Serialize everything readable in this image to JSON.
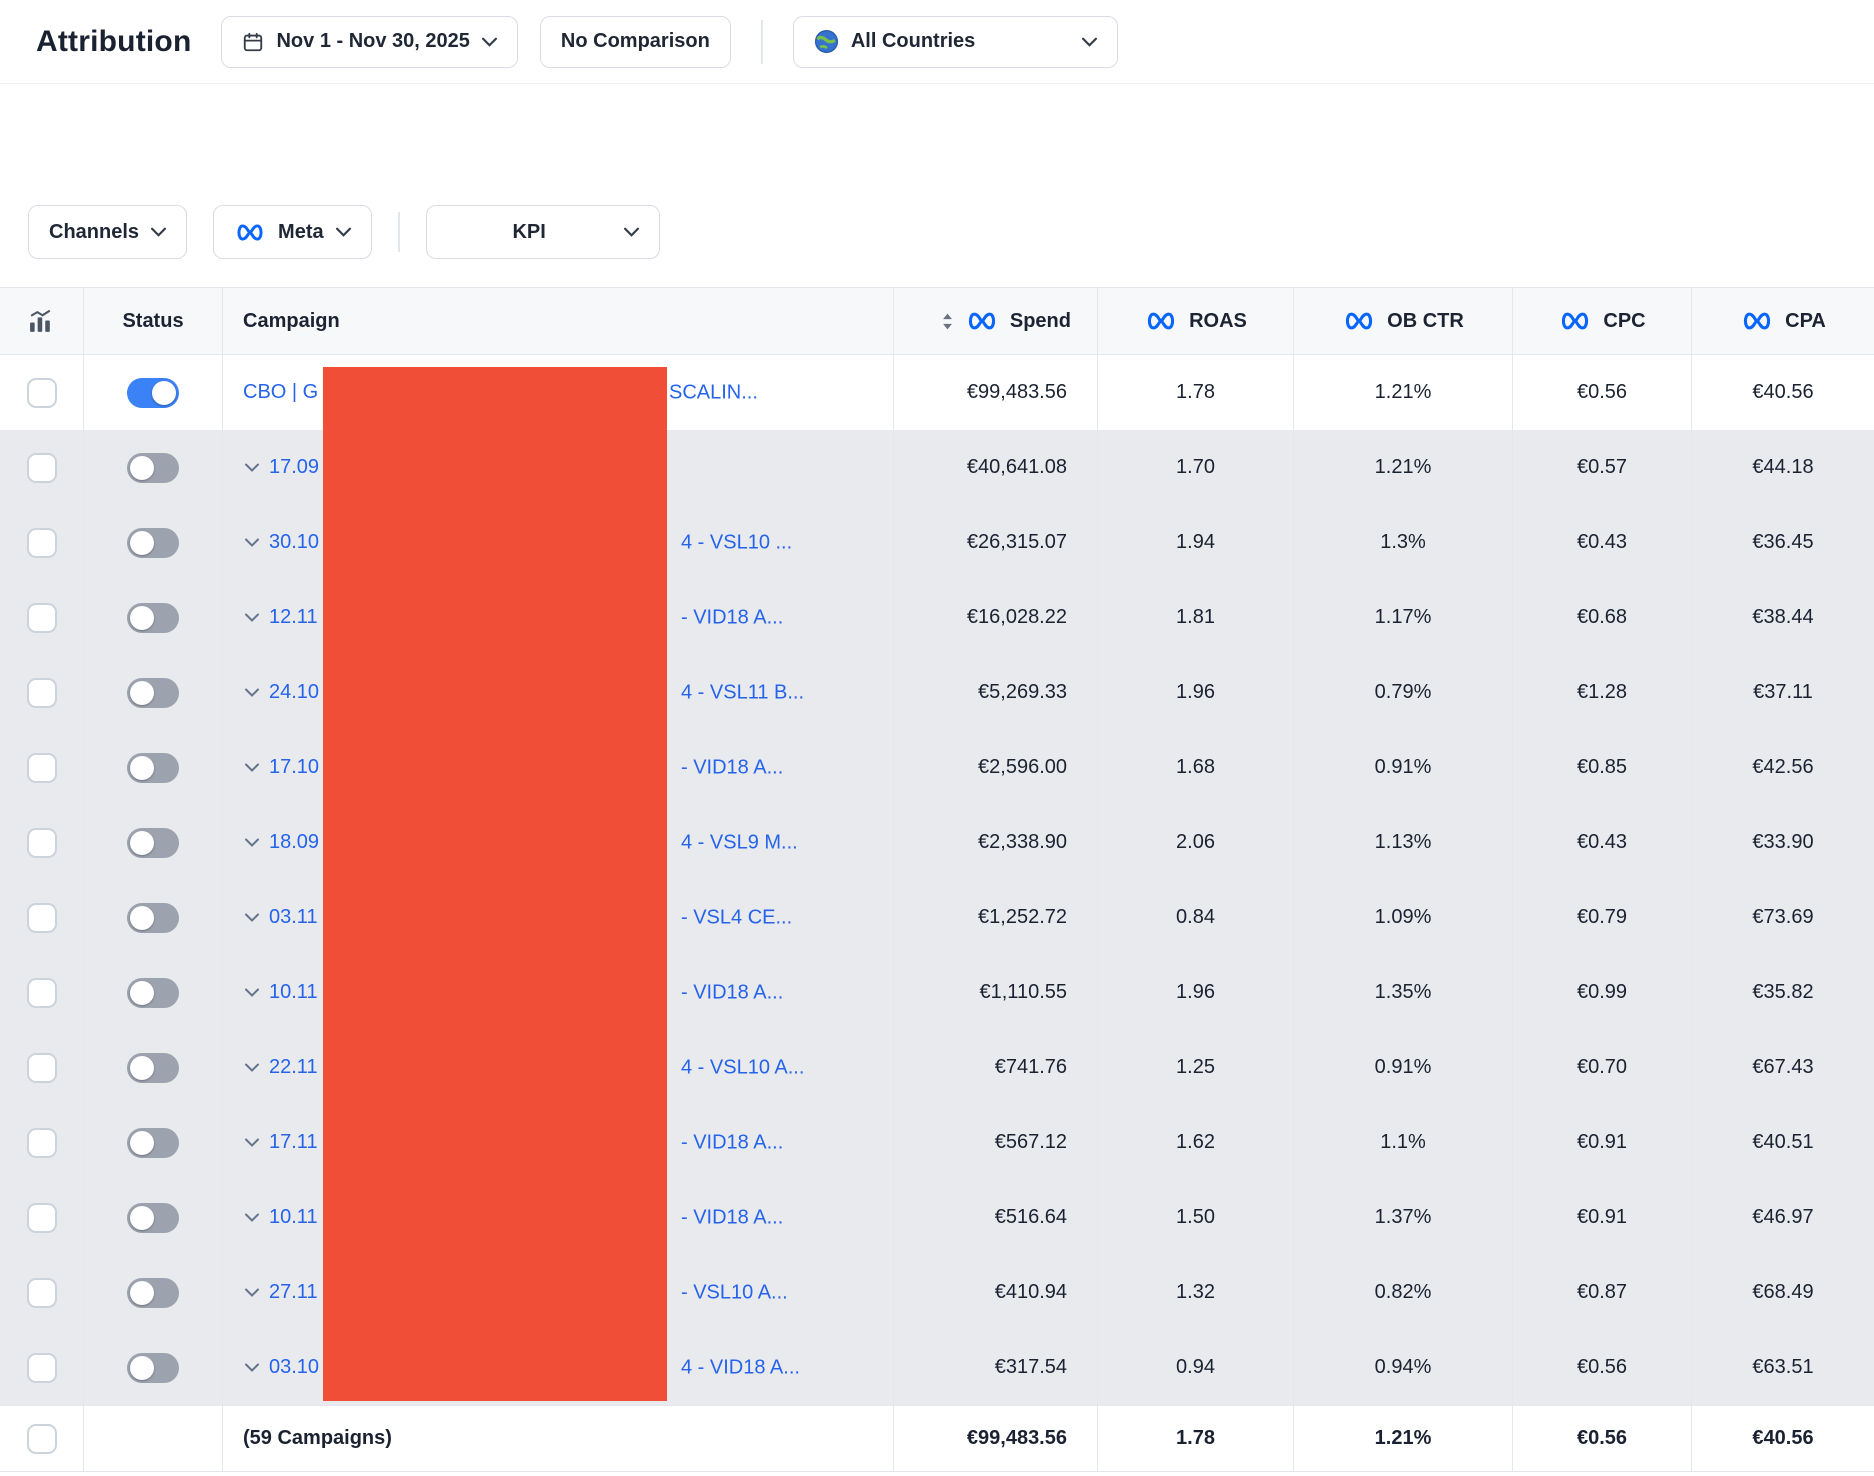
{
  "page": {
    "title": "Attribution"
  },
  "toolbar": {
    "date_range": "Nov 1 - Nov 30, 2025",
    "comparison": "No Comparison",
    "countries": "All Countries"
  },
  "filters": {
    "channels_label": "Channels",
    "channel_selected": "Meta",
    "kpi_label": "KPI"
  },
  "table": {
    "columns": {
      "status": "Status",
      "campaign": "Campaign",
      "spend": "Spend",
      "roas": "ROAS",
      "ob_ctr": "OB CTR",
      "cpc": "CPC",
      "cpa": "CPA"
    },
    "rows": [
      {
        "name_left": "CBO | G",
        "name_right": "SCALIN...",
        "toggle": "on",
        "spend": "€99,483.56",
        "roas": "1.78",
        "ob_ctr": "1.21%",
        "cpc": "€0.56",
        "cpa": "€40.56"
      },
      {
        "name_left": "17.09",
        "name_right": "",
        "toggle": "off",
        "spend": "€40,641.08",
        "roas": "1.70",
        "ob_ctr": "1.21%",
        "cpc": "€0.57",
        "cpa": "€44.18"
      },
      {
        "name_left": "30.10",
        "name_right": "4 - VSL10 ...",
        "toggle": "off",
        "spend": "€26,315.07",
        "roas": "1.94",
        "ob_ctr": "1.3%",
        "cpc": "€0.43",
        "cpa": "€36.45"
      },
      {
        "name_left": "12.11",
        "name_right": "- VID18 A...",
        "toggle": "off",
        "spend": "€16,028.22",
        "roas": "1.81",
        "ob_ctr": "1.17%",
        "cpc": "€0.68",
        "cpa": "€38.44"
      },
      {
        "name_left": "24.10",
        "name_right": "4 - VSL11 B...",
        "toggle": "off",
        "spend": "€5,269.33",
        "roas": "1.96",
        "ob_ctr": "0.79%",
        "cpc": "€1.28",
        "cpa": "€37.11"
      },
      {
        "name_left": "17.10",
        "name_right": "- VID18 A...",
        "toggle": "off",
        "spend": "€2,596.00",
        "roas": "1.68",
        "ob_ctr": "0.91%",
        "cpc": "€0.85",
        "cpa": "€42.56"
      },
      {
        "name_left": "18.09",
        "name_right": "4 - VSL9 M...",
        "toggle": "off",
        "spend": "€2,338.90",
        "roas": "2.06",
        "ob_ctr": "1.13%",
        "cpc": "€0.43",
        "cpa": "€33.90"
      },
      {
        "name_left": "03.11",
        "name_right": "- VSL4 CE...",
        "toggle": "off",
        "spend": "€1,252.72",
        "roas": "0.84",
        "ob_ctr": "1.09%",
        "cpc": "€0.79",
        "cpa": "€73.69"
      },
      {
        "name_left": "10.11",
        "name_right": "- VID18 A...",
        "toggle": "off",
        "spend": "€1,110.55",
        "roas": "1.96",
        "ob_ctr": "1.35%",
        "cpc": "€0.99",
        "cpa": "€35.82"
      },
      {
        "name_left": "22.11",
        "name_right": "4 - VSL10 A...",
        "toggle": "off",
        "spend": "€741.76",
        "roas": "1.25",
        "ob_ctr": "0.91%",
        "cpc": "€0.70",
        "cpa": "€67.43"
      },
      {
        "name_left": "17.11",
        "name_right": "- VID18 A...",
        "toggle": "off",
        "spend": "€567.12",
        "roas": "1.62",
        "ob_ctr": "1.1%",
        "cpc": "€0.91",
        "cpa": "€40.51"
      },
      {
        "name_left": "10.11",
        "name_right": "- VID18 A...",
        "toggle": "off",
        "spend": "€516.64",
        "roas": "1.50",
        "ob_ctr": "1.37%",
        "cpc": "€0.91",
        "cpa": "€46.97"
      },
      {
        "name_left": "27.11",
        "name_right": "- VSL10 A...",
        "toggle": "off",
        "spend": "€410.94",
        "roas": "1.32",
        "ob_ctr": "0.82%",
        "cpc": "€0.87",
        "cpa": "€68.49"
      },
      {
        "name_left": "03.10",
        "name_right": "4 - VID18 A...",
        "toggle": "off",
        "spend": "€317.54",
        "roas": "0.94",
        "ob_ctr": "0.94%",
        "cpc": "€0.56",
        "cpa": "€63.51"
      }
    ],
    "footer": {
      "label": "(59 Campaigns)",
      "spend": "€99,483.56",
      "roas": "1.78",
      "ob_ctr": "1.21%",
      "cpc": "€0.56",
      "cpa": "€40.56"
    }
  },
  "colors": {
    "meta_blue": "#0866FF",
    "link_blue": "#2563EB",
    "toggle_on": "#3B82F6",
    "alt_row_bg": "#E8EAEE",
    "redaction": "#F04E37"
  }
}
